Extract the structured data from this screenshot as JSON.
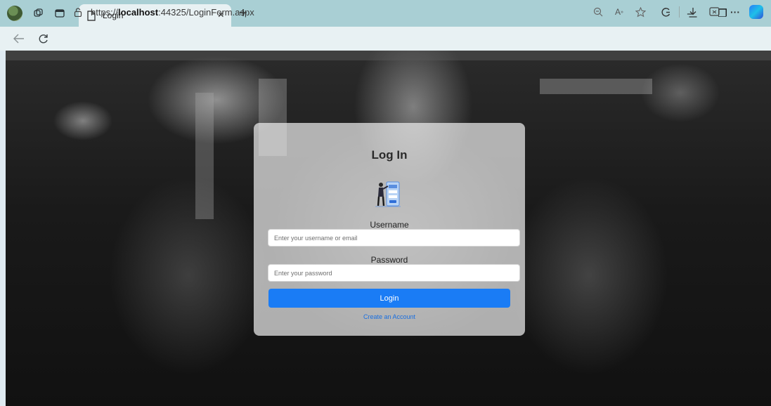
{
  "browser": {
    "tab_title": "Login",
    "url_prefix": "https://",
    "url_host": "localhost",
    "url_rest": ":44325/LoginForm.aspx",
    "new_tab_glyph": "+",
    "close_tab_glyph": "×",
    "window_controls": {
      "minimize": "–",
      "restore": "❐",
      "close": "✕"
    }
  },
  "login_card": {
    "title": "Log In",
    "username_label": "Username",
    "username_placeholder": "Enter your username or email",
    "password_label": "Password",
    "password_placeholder": "Enter your password",
    "login_button": "Login",
    "create_account_link": "Create an Account"
  },
  "colors": {
    "tabbar": "#a9cfd4",
    "addressbar": "#e8f1f3",
    "primary_button": "#1a7cf5",
    "link": "#1a6fe0"
  },
  "icons": [
    "profile-icon",
    "workspaces-icon",
    "tab-actions-icon",
    "document-icon",
    "back-icon",
    "refresh-icon",
    "lock-icon",
    "zoom-icon",
    "read-aloud-icon",
    "favorite-icon",
    "extensions-icon",
    "downloads-icon",
    "screenshot-icon",
    "more-icon",
    "copilot-icon"
  ]
}
